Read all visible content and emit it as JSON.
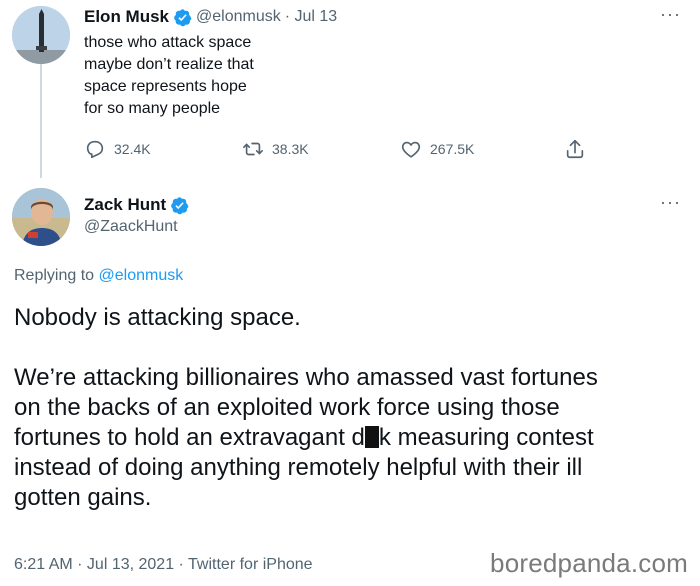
{
  "tweet1": {
    "name": "Elon Musk",
    "handle": "@elonmusk",
    "date": "· Jul 13",
    "text_lines": [
      "those who attack space",
      "maybe don’t realize that",
      "space represents hope",
      "for so many people"
    ],
    "reply_count": "32.4K",
    "retweet_count": "38.3K",
    "like_count": "267.5K"
  },
  "tweet2": {
    "name": "Zack Hunt",
    "handle": "@ZaackHunt",
    "replying_prefix": "Replying to ",
    "replying_handle": "@elonmusk",
    "paragraph1": "Nobody is attacking space.",
    "paragraph2_line1": "We’re attacking billionaires who amassed vast fortunes",
    "paragraph2_line2": "on the backs of an exploited work force using those",
    "paragraph2_line3_before": "fortunes to hold an extravagant d",
    "paragraph2_line3_after": "k measuring contest",
    "paragraph2_line4": "instead of doing anything remotely helpful with their ill",
    "paragraph2_line5": "gotten gains.",
    "timestamp": "6:21 AM · Jul 13, 2021 · Twitter for iPhone"
  },
  "watermark": "boredpanda.com",
  "more_glyph": "···",
  "colors": {
    "verified": "#1d9bf0",
    "muted": "#536471",
    "link": "#1d9bf0"
  },
  "icons": [
    "verified-badge-icon",
    "reply-icon",
    "retweet-icon",
    "like-icon",
    "share-icon",
    "more-icon"
  ]
}
